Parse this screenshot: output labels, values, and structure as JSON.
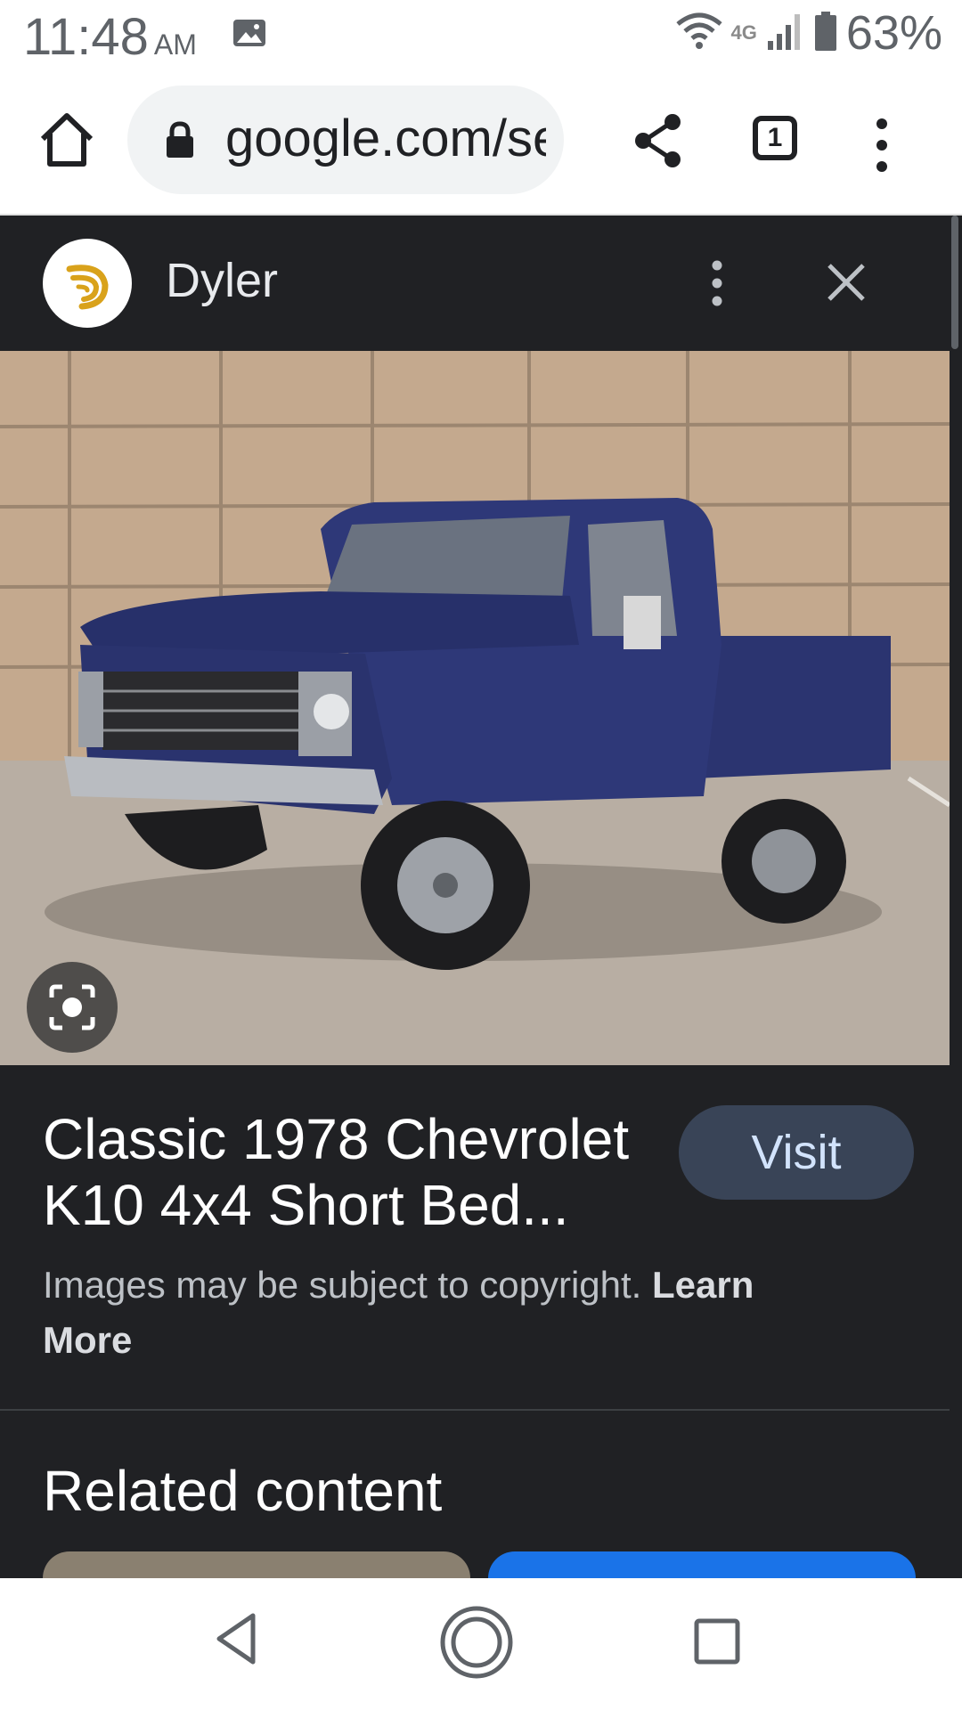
{
  "status_bar": {
    "time": "11:48",
    "ampm": "AM",
    "network": "4G",
    "battery": "63%"
  },
  "browser": {
    "url": "google.com/search",
    "tab_count": "1"
  },
  "viewer": {
    "source_name": "Dyler",
    "title": "Classic 1978 Chevrolet K10 4x4 Short Bed...",
    "visit_label": "Visit",
    "copyright_text": "Images may be subject to copyright.",
    "learn_more": "Learn More",
    "related_heading": "Related content"
  },
  "colors": {
    "panel_bg": "#202124",
    "visit_button": "#394457",
    "accent_blue": "#1a73e8",
    "logo_gold": "#d9a21b"
  }
}
